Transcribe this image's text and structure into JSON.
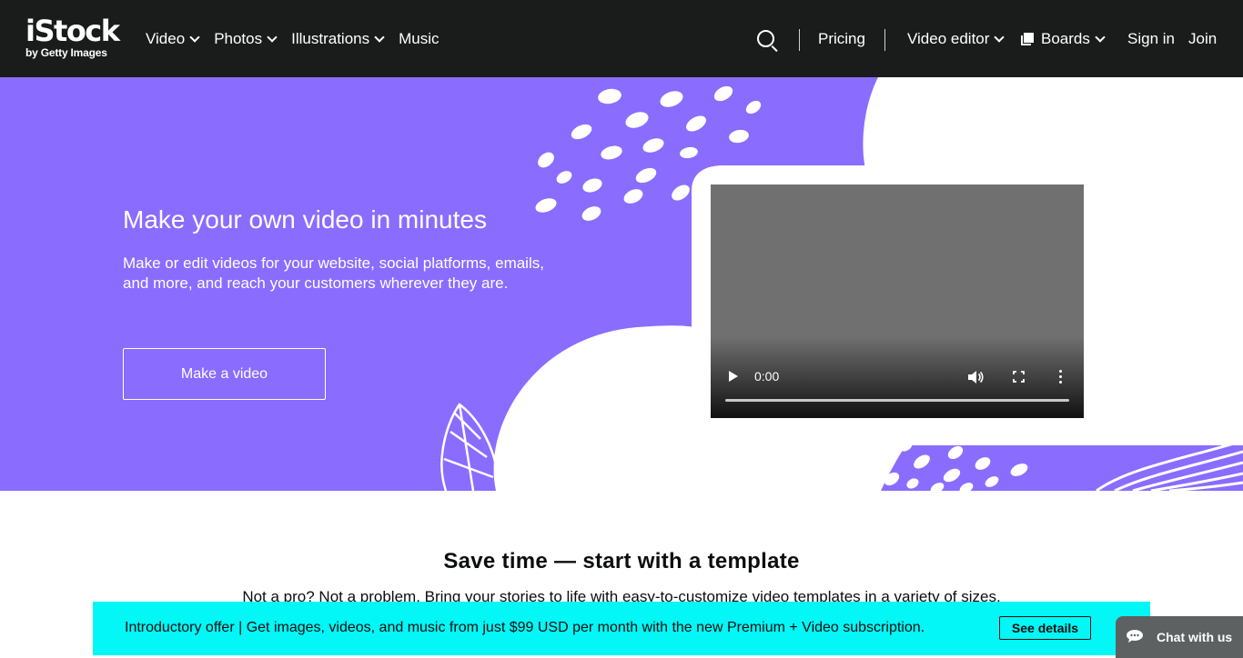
{
  "header": {
    "logo_brand": "iStock",
    "logo_sub": "by Getty Images",
    "nav": [
      {
        "label": "Video",
        "dropdown": true
      },
      {
        "label": "Photos",
        "dropdown": true
      },
      {
        "label": "Illustrations",
        "dropdown": true
      },
      {
        "label": "Music",
        "dropdown": false
      }
    ],
    "pricing": "Pricing",
    "video_editor": "Video editor",
    "boards": "Boards",
    "sign_in": "Sign in",
    "join": "Join"
  },
  "hero": {
    "title": "Make your own video in minutes",
    "subtitle": "Make or edit videos for your website, social platforms, emails, and more, and reach your customers wherever they are.",
    "cta": "Make a video",
    "background_color": "#8a6cff",
    "video": {
      "time": "0:00",
      "progress": 0
    }
  },
  "templates": {
    "title": "Save time — start with a template",
    "description": "Not a pro? Not a problem. Bring your stories to life with easy-to-customize video templates in a variety of sizes."
  },
  "banner": {
    "text": "Introductory offer | Get images, videos, and music from just $99 USD per month with the new Premium + Video subscription.",
    "button": "See details",
    "color": "#02f7f6"
  },
  "chat": {
    "label": "Chat with us"
  }
}
